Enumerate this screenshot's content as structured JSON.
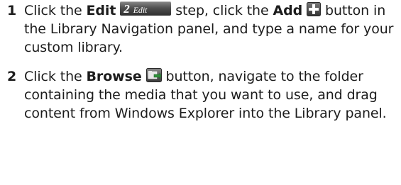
{
  "steps": [
    {
      "number": "1",
      "text_a": "Click the ",
      "bold_a": "Edit",
      "badge_number": "2",
      "badge_label": "Edit",
      "text_b": " step, click the ",
      "bold_b": "Add",
      "text_c": " button in the Library Navigation panel, and type a name for your custom library.",
      "icon_b": "add-plus-icon"
    },
    {
      "number": "2",
      "text_a": "Click the ",
      "bold_a": "Browse",
      "text_b": " button, navigate to the folder containing the media that you want to use, and drag content from Windows Explorer into the Library panel.",
      "icon_a": "browse-folder-arrow-icon"
    }
  ],
  "colors": {
    "text": "#1c1c1c",
    "badge_dark": "#2e2e2e",
    "icon_green": "#2f8f3a"
  }
}
